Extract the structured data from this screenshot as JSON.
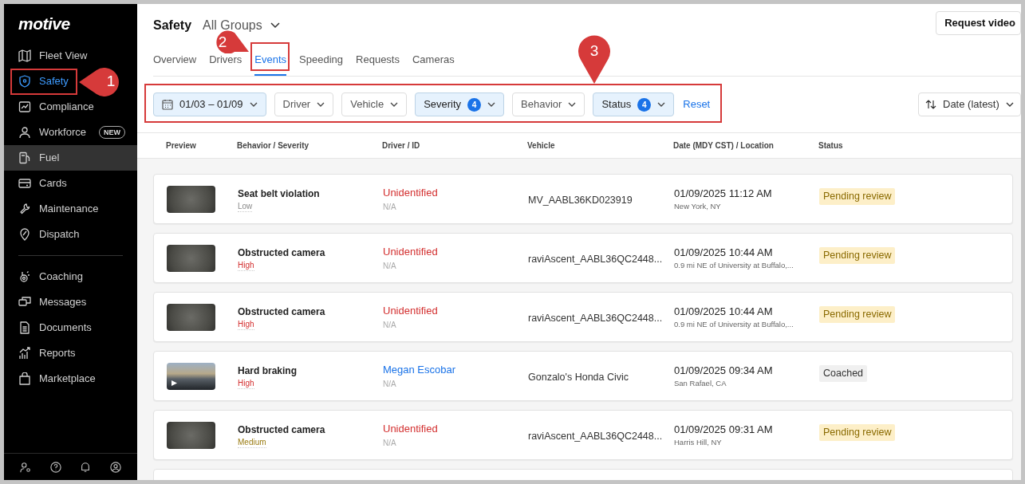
{
  "sidebar": {
    "logo": "motive",
    "primary_items": [
      {
        "label": "Fleet View",
        "selected": false,
        "hovered": false
      },
      {
        "label": "Safety",
        "selected": true,
        "hovered": false
      },
      {
        "label": "Compliance",
        "selected": false,
        "hovered": false
      },
      {
        "label": "Workforce",
        "selected": false,
        "hovered": false,
        "badge": "NEW"
      },
      {
        "label": "Fuel",
        "selected": false,
        "hovered": true
      },
      {
        "label": "Cards",
        "selected": false,
        "hovered": false
      },
      {
        "label": "Maintenance",
        "selected": false,
        "hovered": false
      },
      {
        "label": "Dispatch",
        "selected": false,
        "hovered": false
      }
    ],
    "secondary_items": [
      {
        "label": "Coaching",
        "selected": false,
        "hovered": false
      },
      {
        "label": "Messages",
        "selected": false,
        "hovered": false
      },
      {
        "label": "Documents",
        "selected": false,
        "hovered": false
      },
      {
        "label": "Reports",
        "selected": false,
        "hovered": false
      },
      {
        "label": "Marketplace",
        "selected": false,
        "hovered": false
      }
    ]
  },
  "header": {
    "title": "Safety",
    "group_selector": "All Groups",
    "request_button": "Request video"
  },
  "tabs": [
    {
      "label": "Overview",
      "selected": false
    },
    {
      "label": "Drivers",
      "selected": false
    },
    {
      "label": "Events",
      "selected": true
    },
    {
      "label": "Speeding",
      "selected": false
    },
    {
      "label": "Requests",
      "selected": false
    },
    {
      "label": "Cameras",
      "selected": false
    }
  ],
  "filters": [
    {
      "kind": "date",
      "label": "01/03 – 01/09",
      "active": true
    },
    {
      "kind": "dropdown",
      "label": "Driver",
      "active": false
    },
    {
      "kind": "dropdown",
      "label": "Vehicle",
      "active": false
    },
    {
      "kind": "dropdown",
      "label": "Severity",
      "count": "4",
      "active": true
    },
    {
      "kind": "dropdown",
      "label": "Behavior",
      "active": false
    },
    {
      "kind": "dropdown",
      "label": "Status",
      "count": "4",
      "active": true
    }
  ],
  "reset_link": "Reset",
  "sort": "Date (latest)",
  "table": {
    "columns": [
      "Preview",
      "Behavior / Severity",
      "Driver / ID",
      "Vehicle",
      "Date (MDY CST) / Location",
      "Status"
    ],
    "rows": [
      {
        "kind": "snapshot",
        "behavior": "Seat belt violation",
        "severity": {
          "text": "Low",
          "color": "#8a8a8a"
        },
        "driver": "Unidentified",
        "identified": false,
        "driver_id": "N/A",
        "vehicle": "MV_AABL36KD023919",
        "date": "01/09/2025 11:12 AM",
        "location": "New York, NY",
        "status": {
          "text": "Pending review",
          "kind": "pending"
        }
      },
      {
        "kind": "snapshot",
        "behavior": "Obstructed camera",
        "severity": {
          "text": "High",
          "color": "#d32f2f"
        },
        "driver": "Unidentified",
        "identified": false,
        "driver_id": "N/A",
        "vehicle": "raviAscent_AABL36QC2448...",
        "date": "01/09/2025 10:44 AM",
        "location": "0.9 mi NE of University at Buffalo,...",
        "status": {
          "text": "Pending review",
          "kind": "pending"
        }
      },
      {
        "kind": "snapshot",
        "behavior": "Obstructed camera",
        "severity": {
          "text": "High",
          "color": "#d32f2f"
        },
        "driver": "Unidentified",
        "identified": false,
        "driver_id": "N/A",
        "vehicle": "raviAscent_AABL36QC2448...",
        "date": "01/09/2025 10:44 AM",
        "location": "0.9 mi NE of University at Buffalo,...",
        "status": {
          "text": "Pending review",
          "kind": "pending"
        }
      },
      {
        "kind": "video",
        "behavior": "Hard braking",
        "severity": {
          "text": "High",
          "color": "#d32f2f"
        },
        "driver": "Megan Escobar",
        "identified": true,
        "driver_id": "N/A",
        "vehicle": "Gonzalo's Honda Civic",
        "date": "01/09/2025 09:34 AM",
        "location": "San Rafael, CA",
        "status": {
          "text": "Coached",
          "kind": "coached"
        }
      },
      {
        "kind": "snapshot",
        "behavior": "Obstructed camera",
        "severity": {
          "text": "Medium",
          "color": "#9a7b12"
        },
        "driver": "Unidentified",
        "identified": false,
        "driver_id": "N/A",
        "vehicle": "raviAscent_AABL36QC2448...",
        "date": "01/09/2025 09:31 AM",
        "location": "Harris Hill, NY",
        "status": {
          "text": "Pending review",
          "kind": "pending"
        }
      }
    ]
  },
  "annotations": [
    {
      "number": "1"
    },
    {
      "number": "2"
    },
    {
      "number": "3"
    }
  ]
}
